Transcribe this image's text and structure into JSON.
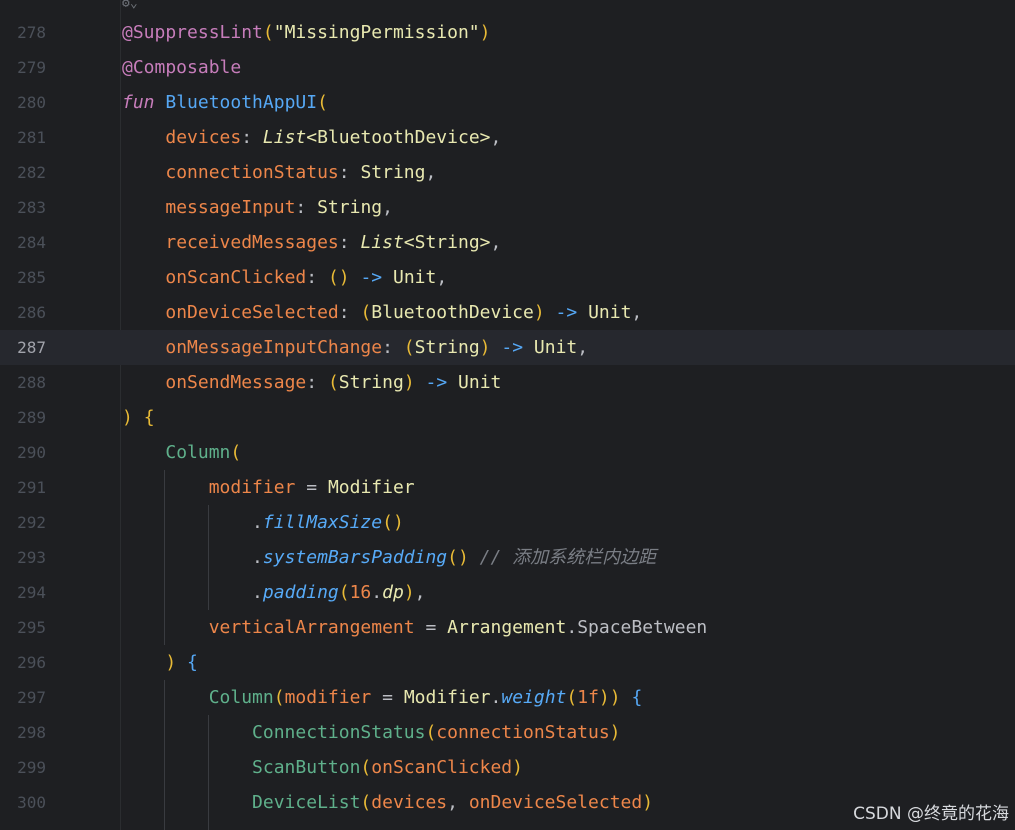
{
  "editor": {
    "current_line": 287,
    "lines": [
      {
        "no": "278",
        "text": "@SuppressLint(\"MissingPermission\")"
      },
      {
        "no": "279",
        "text": "@Composable"
      },
      {
        "no": "280",
        "text": "fun BluetoothAppUI("
      },
      {
        "no": "281",
        "text": "    devices: List<BluetoothDevice>,"
      },
      {
        "no": "282",
        "text": "    connectionStatus: String,"
      },
      {
        "no": "283",
        "text": "    messageInput: String,"
      },
      {
        "no": "284",
        "text": "    receivedMessages: List<String>,"
      },
      {
        "no": "285",
        "text": "    onScanClicked: () -> Unit,"
      },
      {
        "no": "286",
        "text": "    onDeviceSelected: (BluetoothDevice) -> Unit,"
      },
      {
        "no": "287",
        "text": "    onMessageInputChange: (String) -> Unit,"
      },
      {
        "no": "288",
        "text": "    onSendMessage: (String) -> Unit"
      },
      {
        "no": "289",
        "text": ") {"
      },
      {
        "no": "290",
        "text": "    Column("
      },
      {
        "no": "291",
        "text": "        modifier = Modifier"
      },
      {
        "no": "292",
        "text": "            .fillMaxSize()"
      },
      {
        "no": "293",
        "text": "            .systemBarsPadding() // 添加系统栏内边距"
      },
      {
        "no": "294",
        "text": "            .padding(16.dp),"
      },
      {
        "no": "295",
        "text": "        verticalArrangement = Arrangement.SpaceBetween"
      },
      {
        "no": "296",
        "text": "    ) {"
      },
      {
        "no": "297",
        "text": "        Column(modifier = Modifier.weight(1f)) {"
      },
      {
        "no": "298",
        "text": "            ConnectionStatus(connectionStatus)"
      },
      {
        "no": "299",
        "text": "            ScanButton(onScanClicked)"
      },
      {
        "no": "300",
        "text": "            DeviceList(devices, onDeviceSelected)"
      }
    ]
  },
  "watermark": "CSDN @终竟的花海",
  "fold_icon": "fold-marker-icon"
}
